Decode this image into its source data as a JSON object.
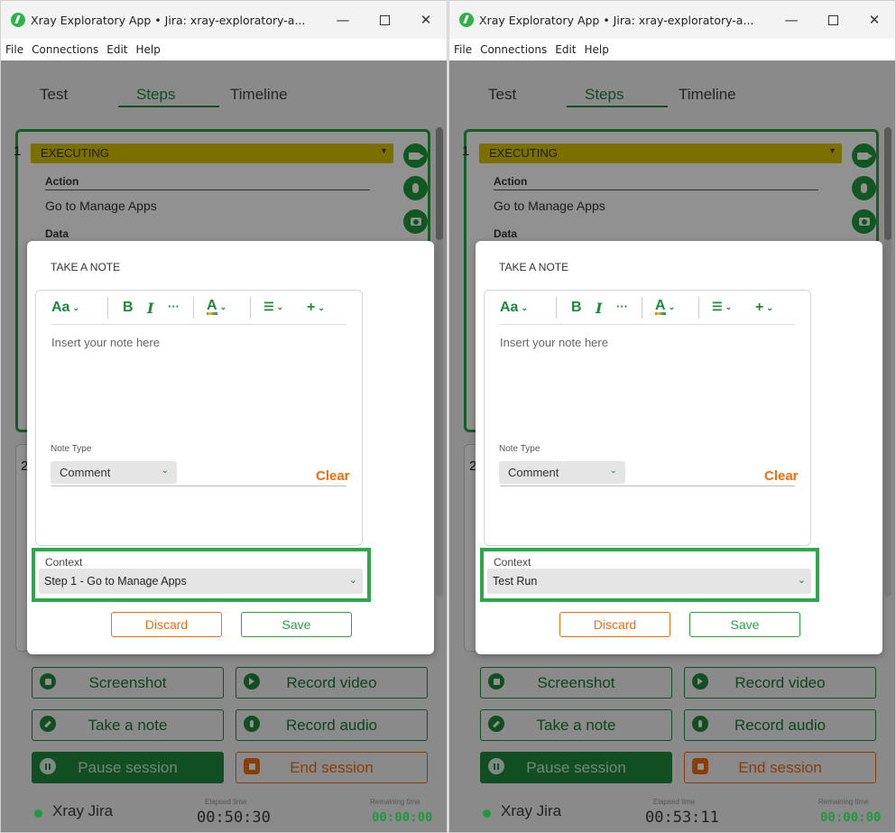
{
  "windows": [
    {
      "title": "Xray Exploratory App • Jira: xray-exploratory-a...",
      "menu": [
        "File",
        "Connections",
        "Edit",
        "Help"
      ],
      "tabs": [
        "Test",
        "Steps",
        "Timeline"
      ],
      "active_tab": "Steps",
      "step": {
        "number": "1",
        "status": "EXECUTING",
        "action_label": "Action",
        "action_value": "Go to Manage Apps",
        "data_label": "Data"
      },
      "step2_number": "2",
      "note_dialog": {
        "title": "TAKE A NOTE",
        "toolbar": {
          "font": "Aa",
          "bold": "B",
          "italic": "I",
          "more": "···",
          "color": "A",
          "list": "☰",
          "insert": "+"
        },
        "placeholder": "Insert your note here",
        "note_type_label": "Note Type",
        "note_type_value": "Comment",
        "clear_label": "Clear",
        "context_label": "Context",
        "context_value": "Step 1 - Go to Manage Apps",
        "discard_label": "Discard",
        "save_label": "Save"
      },
      "actions": {
        "screenshot": "Screenshot",
        "record_video": "Record video",
        "take_note": "Take a note",
        "record_audio": "Record audio",
        "pause_session": "Pause session",
        "end_session": "End session"
      },
      "footer": {
        "brand": "Xray Jira",
        "elapsed_label": "Elapsed time",
        "elapsed_value": "00:50:30",
        "remaining_label": "Remaining time",
        "remaining_value": "00:00:00"
      }
    },
    {
      "title": "Xray Exploratory App • Jira: xray-exploratory-a...",
      "menu": [
        "File",
        "Connections",
        "Edit",
        "Help"
      ],
      "tabs": [
        "Test",
        "Steps",
        "Timeline"
      ],
      "active_tab": "Steps",
      "step": {
        "number": "1",
        "status": "EXECUTING",
        "action_label": "Action",
        "action_value": "Go to Manage Apps",
        "data_label": "Data"
      },
      "step2_number": "2",
      "note_dialog": {
        "title": "TAKE A NOTE",
        "toolbar": {
          "font": "Aa",
          "bold": "B",
          "italic": "I",
          "more": "···",
          "color": "A",
          "list": "☰",
          "insert": "+"
        },
        "placeholder": "Insert your note here",
        "note_type_label": "Note Type",
        "note_type_value": "Comment",
        "clear_label": "Clear",
        "context_label": "Context",
        "context_value": "Test Run",
        "discard_label": "Discard",
        "save_label": "Save"
      },
      "actions": {
        "screenshot": "Screenshot",
        "record_video": "Record video",
        "take_note": "Take a note",
        "record_audio": "Record audio",
        "pause_session": "Pause session",
        "end_session": "End session"
      },
      "footer": {
        "brand": "Xray Jira",
        "elapsed_label": "Elapsed time",
        "elapsed_value": "00:53:11",
        "remaining_label": "Remaining time",
        "remaining_value": "00:00:00"
      }
    }
  ],
  "colors": {
    "brand_green": "#1e8a3a",
    "executing_yellow": "#d9c400",
    "accent_orange": "#f36b0c",
    "highlight_green": "#2ba84a"
  },
  "icons": [
    "app-logo-icon",
    "minimize-icon",
    "maximize-icon",
    "close-icon",
    "video-icon",
    "microphone-icon",
    "camera-icon",
    "chevron-down-icon",
    "screenshot-icon",
    "pencil-icon",
    "pause-icon",
    "stop-icon"
  ]
}
